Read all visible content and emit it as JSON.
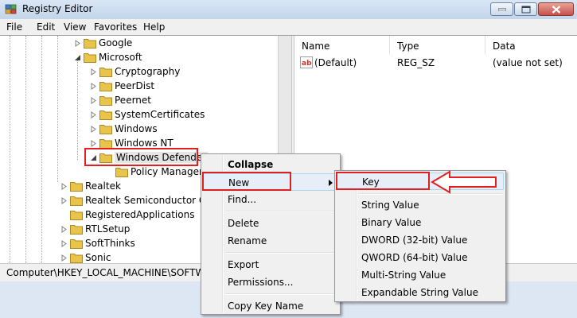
{
  "window": {
    "title": "Registry Editor"
  },
  "menubar": {
    "items": [
      "File",
      "Edit",
      "View",
      "Favorites",
      "Help"
    ]
  },
  "tree": {
    "items": [
      {
        "label": "Google",
        "level": 4,
        "expander": "collapsed"
      },
      {
        "label": "Microsoft",
        "level": 4,
        "expander": "expanded"
      },
      {
        "label": "Cryptography",
        "level": 5,
        "expander": "collapsed"
      },
      {
        "label": "PeerDist",
        "level": 5,
        "expander": "collapsed"
      },
      {
        "label": "Peernet",
        "level": 5,
        "expander": "collapsed"
      },
      {
        "label": "SystemCertificates",
        "level": 5,
        "expander": "collapsed"
      },
      {
        "label": "Windows",
        "level": 5,
        "expander": "collapsed"
      },
      {
        "label": "Windows NT",
        "level": 5,
        "expander": "collapsed"
      },
      {
        "label": "Windows Defender",
        "level": 5,
        "expander": "expanded",
        "selected": true
      },
      {
        "label": "Policy Manager",
        "level": 6,
        "expander": "none"
      },
      {
        "label": "Realtek",
        "level": 3,
        "expander": "collapsed"
      },
      {
        "label": "Realtek Semiconductor Cor",
        "level": 3,
        "expander": "collapsed"
      },
      {
        "label": "RegisteredApplications",
        "level": 3,
        "expander": "none"
      },
      {
        "label": "RTLSetup",
        "level": 3,
        "expander": "collapsed"
      },
      {
        "label": "SoftThinks",
        "level": 3,
        "expander": "collapsed"
      },
      {
        "label": "Sonic",
        "level": 3,
        "expander": "collapsed"
      }
    ]
  },
  "list": {
    "columns": [
      "Name",
      "Type",
      "Data"
    ],
    "rows": [
      {
        "name": "(Default)",
        "type": "REG_SZ",
        "data": "(value not set)",
        "icon": "string-value-icon"
      }
    ]
  },
  "status": {
    "path": "Computer\\HKEY_LOCAL_MACHINE\\SOFTWA"
  },
  "context_menu": {
    "items": [
      "Collapse",
      "New",
      "Find...",
      "Delete",
      "Rename",
      "Export",
      "Permissions...",
      "Copy Key Name"
    ],
    "highlighted": "New"
  },
  "submenu": {
    "items": [
      "Key",
      "String Value",
      "Binary Value",
      "DWORD (32-bit) Value",
      "QWORD (64-bit) Value",
      "Multi-String Value",
      "Expandable String Value"
    ],
    "highlighted": "Key"
  },
  "colors": {
    "annotation_red": "#e02020",
    "folder_yellow": "#e9c44b",
    "menu_highlight": "#e8eef7"
  }
}
